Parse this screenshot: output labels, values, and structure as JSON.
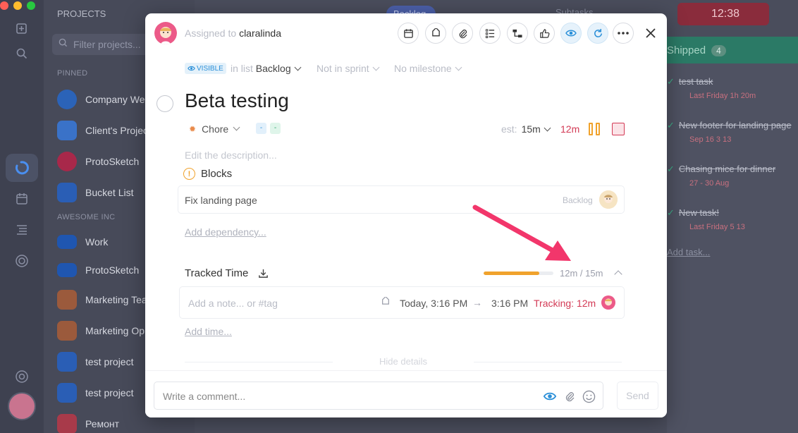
{
  "window": {
    "traffic_colors": [
      "#ff5f57",
      "#febc2e",
      "#28c840"
    ]
  },
  "projects_panel": {
    "title": "PROJECTS",
    "filter_placeholder": "Filter projects...",
    "sections": [
      "PINNED",
      "AWESOME INC"
    ],
    "pinned": [
      {
        "name": "Company Web",
        "color": "#2b63b8"
      },
      {
        "name": "Client's Projec",
        "color": "#3a72c8"
      },
      {
        "name": "ProtoSketch",
        "color": "#a8284a"
      },
      {
        "name": "Bucket List",
        "color": "#2a5eb5"
      }
    ],
    "awesome": [
      {
        "name": "Work",
        "color": "#1f56b0"
      },
      {
        "name": "ProtoSketch",
        "color": "#1f56b0"
      },
      {
        "name": "Marketing Tea",
        "color": "#9b5a3c"
      },
      {
        "name": "Marketing Op",
        "color": "#9b5a3c"
      },
      {
        "name": "test project",
        "color": "#2a5eb5"
      },
      {
        "name": "test project",
        "color": "#2a5eb5"
      },
      {
        "name": "Ремонт",
        "color": "#a83a4a"
      }
    ]
  },
  "topbar": {
    "tab": "Backlog",
    "subtasks": "Subtasks",
    "timer": "12:38"
  },
  "shipped_column": {
    "title": "Shipped",
    "count": "4",
    "tasks": [
      {
        "title": "test task",
        "meta": "Last Friday  1h 20m"
      },
      {
        "title": "New footer for landing page",
        "meta": "Sep 16  3  13"
      },
      {
        "title": "Chasing mice for dinner",
        "meta": "27 - 30 Aug"
      },
      {
        "title": "New task!",
        "meta": "Last Friday  5  13"
      }
    ],
    "add_task": "Add task..."
  },
  "modal": {
    "assigned_prefix": "Assigned to",
    "assignee": "claralinda",
    "visibility_badge": "VISIBLE",
    "in_list_prefix": "in list",
    "list": "Backlog",
    "sprint": "Not in sprint",
    "milestone": "No milestone",
    "title": "Beta testing",
    "type": "Chore",
    "tag_pills": [
      "-",
      "-"
    ],
    "est_label": "est:",
    "est_value": "15m",
    "elapsed": "12m",
    "description_placeholder": "Edit the description...",
    "blocks_label": "Blocks",
    "dependency": {
      "name": "Fix landing page",
      "list": "Backlog"
    },
    "add_dependency": "Add dependency...",
    "tracked_time_label": "Tracked Time",
    "tracked_ratio": "12m / 15m",
    "tracked_progress": 0.8,
    "time_entry": {
      "note_placeholder": "Add a note... or #tag",
      "from": "Today, 3:16 PM",
      "to": "3:16 PM",
      "tracking": "Tracking: 12m"
    },
    "add_time": "Add time...",
    "hide_details": "Hide details",
    "comment_placeholder": "Write a comment...",
    "send_label": "Send"
  },
  "colors": {
    "accent_blue": "#2a8fd8",
    "timer_red": "#d33a55",
    "progress_orange": "#f0a22c",
    "annotation_arrow": "#f2366b"
  }
}
